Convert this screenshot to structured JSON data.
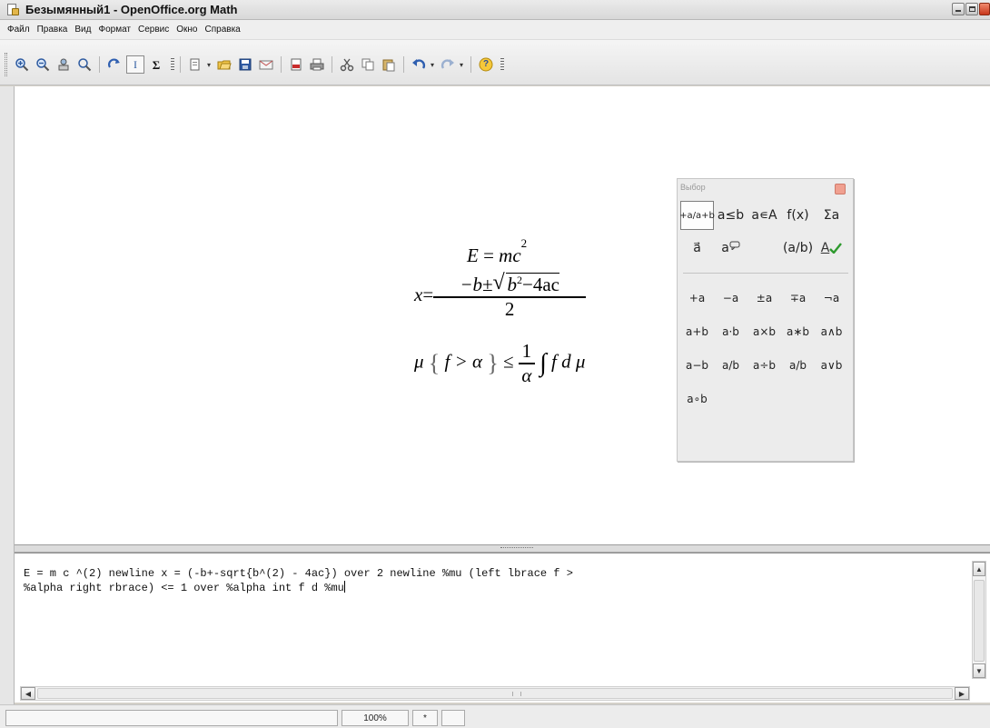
{
  "window": {
    "title": "Безымянный1 - OpenOffice.org Math"
  },
  "menu": {
    "items": [
      "Файл",
      "Правка",
      "Вид",
      "Формат",
      "Сервис",
      "Окно",
      "Справка"
    ]
  },
  "toolbar": {
    "icons": [
      "zoom-in-icon",
      "zoom-out-icon",
      "zoom-100-icon",
      "show-all-icon",
      "refresh-icon",
      "formula-cursor-icon",
      "symbols-icon",
      "new-icon",
      "open-icon",
      "save-icon",
      "email-icon",
      "export-pdf-icon",
      "print-icon",
      "cut-icon",
      "copy-icon",
      "paste-icon",
      "undo-icon",
      "redo-icon",
      "help-icon"
    ],
    "symbols_glyph": "Σ",
    "cursor_glyph": "I",
    "help_glyph": "?"
  },
  "formula_display": {
    "line1": {
      "lhs": "E",
      "eq": "=",
      "rhs": "mc",
      "exp": "2"
    },
    "line2": {
      "lhs": "x",
      "eq": "=",
      "num_prefix": "−b±",
      "sqrt_base": "b",
      "sqrt_exp": "2",
      "sqrt_rest": "−4ac",
      "den": "2"
    },
    "line3": {
      "mu": "μ",
      "lbrace": "{",
      "body": "f > α",
      "rbrace": "}",
      "le": "≤",
      "frac_num": "1",
      "frac_den": "α",
      "integral": "∫",
      "tail": "f d μ"
    }
  },
  "palette": {
    "title": "Выбор",
    "categories_row1": [
      "+a/a+b",
      "a≤b",
      "a∊A",
      "f(x)",
      "Σa"
    ],
    "categories_row2": [
      "a⃗",
      "a",
      "",
      "(a/b)",
      "A"
    ],
    "operators": [
      [
        "+a",
        "−a",
        "±a",
        "∓a",
        "¬a"
      ],
      [
        "a+b",
        "a·b",
        "a×b",
        "a∗b",
        "a∧b"
      ],
      [
        "a−b",
        "a/b",
        "a÷b",
        "a/b",
        "a∨b"
      ],
      [
        "a∘b"
      ]
    ]
  },
  "command": {
    "text_line1": "E = m c ^(2) newline x = (-b+-sqrt{b^(2) - 4ac}) over 2 newline %mu (left lbrace f >",
    "text_line2": "%alpha right rbrace) <= 1 over %alpha int f d %mu"
  },
  "statusbar": {
    "zoom": "100%",
    "modified": "*"
  }
}
